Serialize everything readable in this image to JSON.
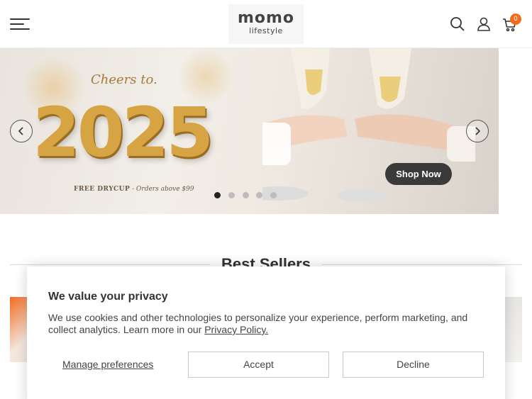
{
  "header": {
    "logo_main": "momo",
    "logo_sub": "lifestyle",
    "cart_count": "0"
  },
  "hero": {
    "headline_small": "Cheers to.",
    "headline_year": "2025",
    "promo_bold": "FREE DRYCUP",
    "promo_rest": " - Orders above $99",
    "cta_label": "Shop Now",
    "slide_count": 5,
    "active_slide": 1
  },
  "section": {
    "title": "Best Sellers"
  },
  "cookie_banner": {
    "title": "We value your privacy",
    "text": "We use cookies and other technologies to personalize your experience, perform marketing, and collect analytics. Learn more in our ",
    "link_label": "Privacy Policy.",
    "manage_label": "Manage preferences",
    "accept_label": "Accept",
    "decline_label": "Decline"
  },
  "colors": {
    "accent": "#f26b1d",
    "gold": "#d6a443",
    "button_dark": "#3a3a3a"
  },
  "icons": [
    "menu-icon",
    "search-icon",
    "user-icon",
    "cart-icon",
    "chevron-left-icon",
    "chevron-right-icon"
  ]
}
